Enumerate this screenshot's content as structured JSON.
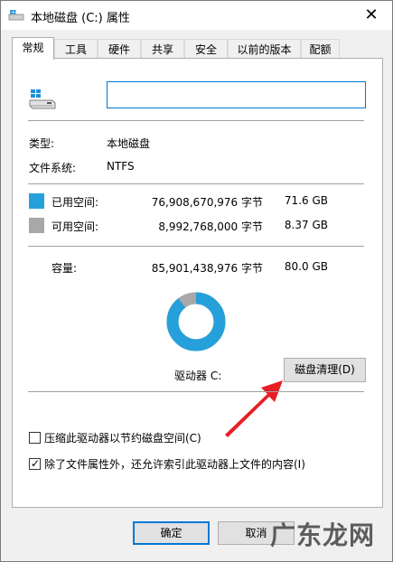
{
  "window": {
    "title": "本地磁盘 (C:) 属性",
    "close_glyph": "✕"
  },
  "tabs": [
    {
      "label": "常规",
      "active": true
    },
    {
      "label": "工具"
    },
    {
      "label": "硬件"
    },
    {
      "label": "共享"
    },
    {
      "label": "安全"
    },
    {
      "label": "以前的版本"
    },
    {
      "label": "配额"
    }
  ],
  "general": {
    "drive_name_value": "",
    "type_label": "类型:",
    "type_value": "本地磁盘",
    "fs_label": "文件系统:",
    "fs_value": "NTFS",
    "used": {
      "label": "已用空间:",
      "bytes": "76,908,670,976 字节",
      "size": "71.6 GB",
      "color": "#26a0da"
    },
    "free": {
      "label": "可用空间:",
      "bytes": "8,992,768,000 字节",
      "size": "8.37 GB",
      "color": "#a8a8a8"
    },
    "capacity": {
      "label": "容量:",
      "bytes": "85,901,438,976 字节",
      "size": "80.0 GB"
    },
    "used_fraction": 0.895,
    "drive_label": "驱动器 C:",
    "cleanup_button": "磁盘清理(D)",
    "compress_option": {
      "label": "压缩此驱动器以节约磁盘空间(C)",
      "checked": false
    },
    "index_option": {
      "label": "除了文件属性外，还允许索引此驱动器上文件的内容(I)",
      "checked": true
    }
  },
  "footer": {
    "ok": "确定",
    "cancel": "取消"
  },
  "watermark": "广东龙网",
  "icons": [
    "drive-icon",
    "close-icon",
    "checkmark-icon",
    "arrow-annotation"
  ],
  "annotation_color": "#e81e25"
}
